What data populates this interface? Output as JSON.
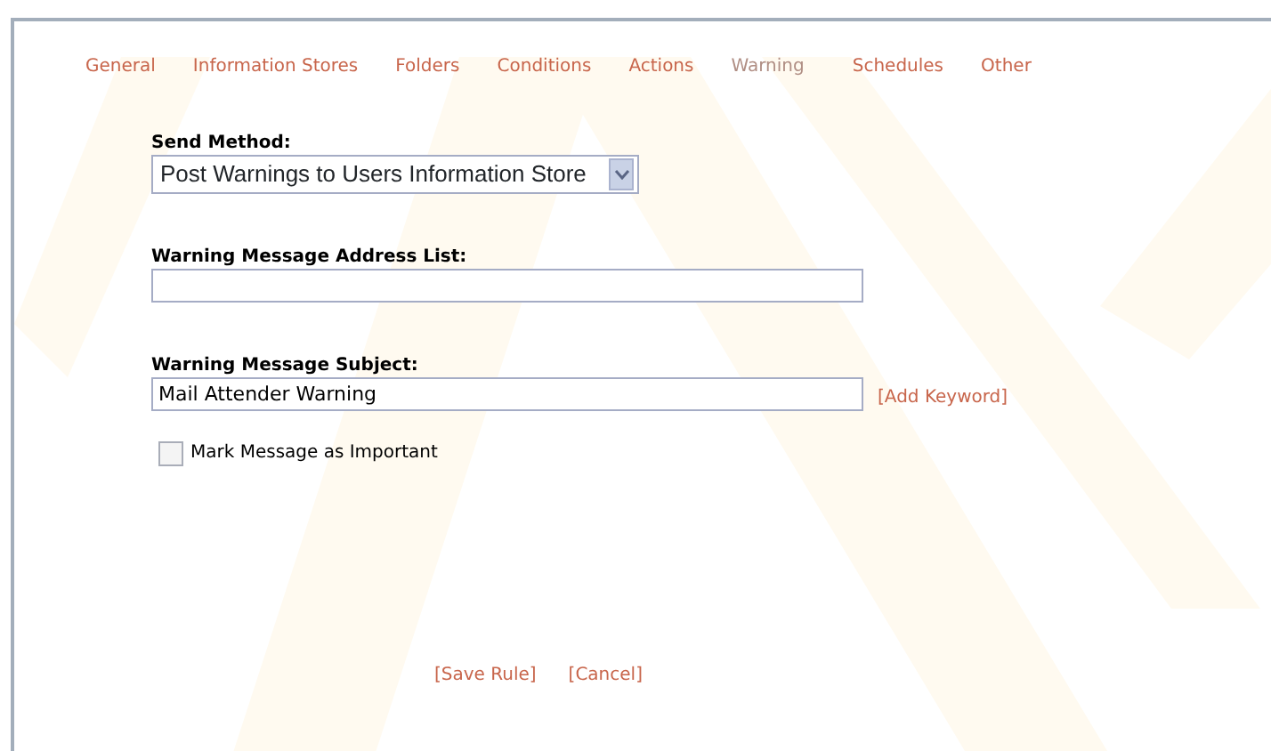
{
  "tabs": [
    {
      "label": "General",
      "selected": false
    },
    {
      "label": "Information Stores",
      "selected": false
    },
    {
      "label": "Folders",
      "selected": false
    },
    {
      "label": "Conditions",
      "selected": false
    },
    {
      "label": "Actions",
      "selected": false
    },
    {
      "label": "Warning",
      "selected": true
    },
    {
      "label": "Schedules",
      "selected": false
    },
    {
      "label": "Other",
      "selected": false
    }
  ],
  "send_method": {
    "label": "Send Method:",
    "value": "Post Warnings to Users Information Store"
  },
  "address_list": {
    "label": "Warning Message Address List:"
  },
  "subject": {
    "label": "Warning Message Subject:",
    "value": "Mail Attender Warning",
    "link": "[Add Keyword]"
  },
  "important": {
    "label": "Mark Message as Important",
    "checked": false
  },
  "actions": [
    "[Save Rule]",
    "[Cancel]"
  ]
}
